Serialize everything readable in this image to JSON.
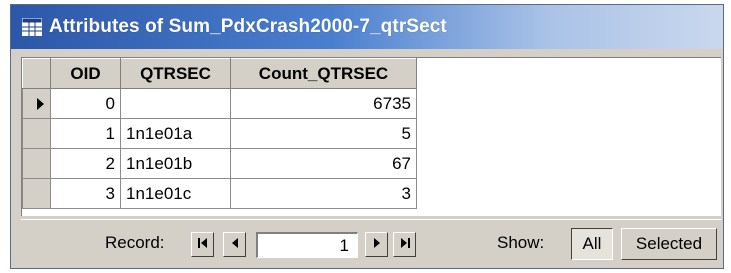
{
  "window": {
    "title": "Attributes of Sum_PdxCrash2000-7_qtrSect",
    "title_icon": "table-icon"
  },
  "table": {
    "columns": [
      "OID",
      "QTRSEC",
      "Count_QTRSEC"
    ],
    "rows": [
      {
        "oid": "0",
        "qtrsec": "",
        "count": "6735",
        "current": true
      },
      {
        "oid": "1",
        "qtrsec": "1n1e01a",
        "count": "5",
        "current": false
      },
      {
        "oid": "2",
        "qtrsec": "1n1e01b",
        "count": "67",
        "current": false
      },
      {
        "oid": "3",
        "qtrsec": "1n1e01c",
        "count": "3",
        "current": false
      }
    ]
  },
  "navigation": {
    "record_label": "Record:",
    "record_value": "1",
    "buttons": [
      "first-record-icon",
      "previous-record-icon",
      "next-record-icon",
      "last-record-icon"
    ]
  },
  "show": {
    "label": "Show:",
    "all_label": "All",
    "selected_label": "Selected",
    "active": "All"
  },
  "colors": {
    "title_bar_start": "#2d57a8",
    "title_bar_end": "#cad8ee",
    "face": "#d4d0c8"
  }
}
